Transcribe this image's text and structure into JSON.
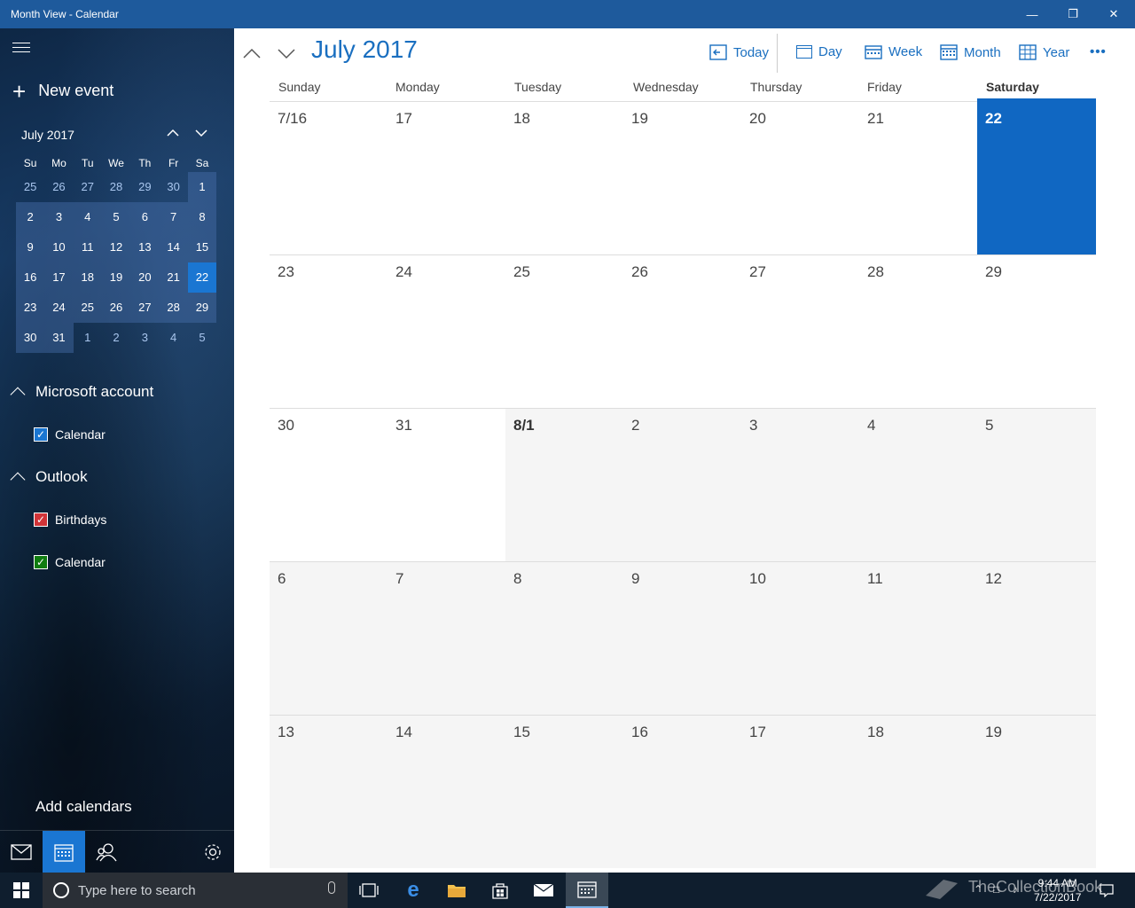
{
  "window": {
    "title": "Month View - Calendar"
  },
  "sidebar": {
    "new_event": "New event",
    "mini_calendar": {
      "title": "July 2017",
      "weekdays": [
        "Su",
        "Mo",
        "Tu",
        "We",
        "Th",
        "Fr",
        "Sa"
      ],
      "rows": [
        [
          "25",
          "26",
          "27",
          "28",
          "29",
          "30",
          "1"
        ],
        [
          "2",
          "3",
          "4",
          "5",
          "6",
          "7",
          "8"
        ],
        [
          "9",
          "10",
          "11",
          "12",
          "13",
          "14",
          "15"
        ],
        [
          "16",
          "17",
          "18",
          "19",
          "20",
          "21",
          "22"
        ],
        [
          "23",
          "24",
          "25",
          "26",
          "27",
          "28",
          "29"
        ],
        [
          "30",
          "31",
          "1",
          "2",
          "3",
          "4",
          "5"
        ]
      ],
      "selected": "22"
    },
    "accounts": [
      {
        "name": "Microsoft account",
        "calendars": [
          {
            "label": "Calendar",
            "color": "#1a76d2"
          }
        ]
      },
      {
        "name": "Outlook",
        "calendars": [
          {
            "label": "Birthdays",
            "color": "#d13438"
          },
          {
            "label": "Calendar",
            "color": "#107c10"
          }
        ]
      }
    ],
    "add_calendars": "Add calendars"
  },
  "toolbar": {
    "month_title": "July 2017",
    "today": "Today",
    "day": "Day",
    "week": "Week",
    "month": "Month",
    "year": "Year",
    "more": "•••"
  },
  "month_view": {
    "weekdays": [
      "Sunday",
      "Monday",
      "Tuesday",
      "Wednesday",
      "Thursday",
      "Friday",
      "Saturday"
    ],
    "weeks": [
      [
        "7/16",
        "17",
        "18",
        "19",
        "20",
        "21",
        "22"
      ],
      [
        "23",
        "24",
        "25",
        "26",
        "27",
        "28",
        "29"
      ],
      [
        "30",
        "31",
        "8/1",
        "2",
        "3",
        "4",
        "5"
      ],
      [
        "6",
        "7",
        "8",
        "9",
        "10",
        "11",
        "12"
      ],
      [
        "13",
        "14",
        "15",
        "16",
        "17",
        "18",
        "19"
      ]
    ],
    "today": "22"
  },
  "taskbar": {
    "search_placeholder": "Type here to search",
    "time": "9:44 AM",
    "date": "7/22/2017",
    "watermark": "TheCollectionBook"
  },
  "colors": {
    "accent": "#1a6fc0",
    "today_fill": "#1067c2",
    "titlebar": "#1e5a9c"
  }
}
